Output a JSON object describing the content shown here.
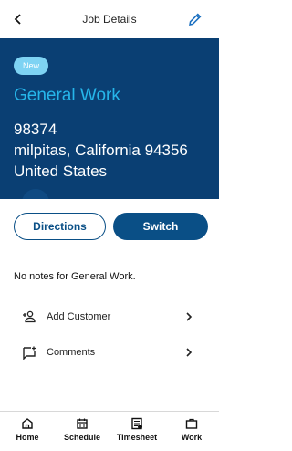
{
  "header": {
    "title": "Job Details",
    "back_icon": "chevron-left-icon",
    "edit_icon": "pencil-icon"
  },
  "job": {
    "badge": "New",
    "title": "General Work",
    "address_line1": "98374",
    "address_line2": "milpitas, California 94356",
    "address_line3": "United States"
  },
  "actions": {
    "directions": "Directions",
    "switch": "Switch"
  },
  "notes": "No notes for General Work.",
  "menu": [
    {
      "label": "Add Customer",
      "icon": "add-person-icon"
    },
    {
      "label": "Comments",
      "icon": "add-comment-icon"
    }
  ],
  "tabs": [
    {
      "label": "Home",
      "icon": "home-icon"
    },
    {
      "label": "Schedule",
      "icon": "calendar-icon"
    },
    {
      "label": "Timesheet",
      "icon": "timesheet-icon"
    },
    {
      "label": "Work",
      "icon": "briefcase-icon"
    }
  ],
  "colors": {
    "primary": "#0a4f86",
    "hero_bg": "#0a3f73",
    "accent": "#26b6ea",
    "badge": "#7ed3f3"
  }
}
